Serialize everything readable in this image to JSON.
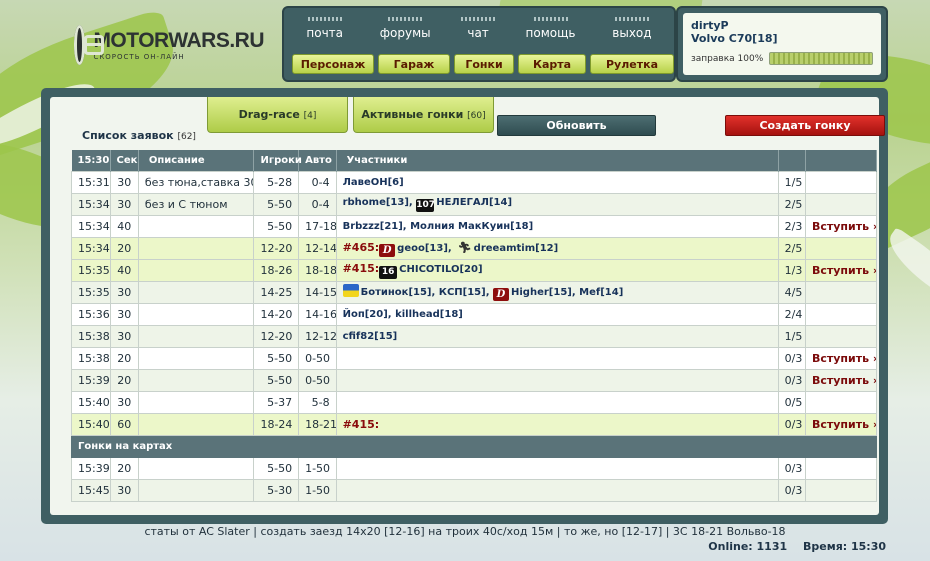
{
  "logo": {
    "title": "MOTORWARS.RU",
    "subtitle": "скорость он-лайн"
  },
  "nav": {
    "top": [
      "почта",
      "форумы",
      "чат",
      "помощь",
      "выход"
    ],
    "bottom": [
      "Персонаж",
      "Гараж",
      "Гонки",
      "Карта",
      "Рулетка"
    ]
  },
  "user": {
    "name": "dirtyP",
    "car": "Volvo C70[18]",
    "fuel_label": "заправка 100%",
    "fuel_level": 1.0
  },
  "panel": {
    "title": "Список заявок",
    "title_count": "[62]",
    "tab1_label": "Drag-race",
    "tab1_count": "[4]",
    "tab2_label": "Активные гонки",
    "tab2_count": "[60]",
    "refresh": "Обновить",
    "create": "Создать гонку"
  },
  "table": {
    "headers": [
      "15:30",
      "Сек",
      "Описание",
      "Игроки",
      "Авто",
      "Участники"
    ],
    "join_label": "Вступить »",
    "rows": [
      {
        "time": "15:31",
        "sec": "30",
        "desc": "без тюна,ставка 300",
        "players": "5-28",
        "auto": "0-4",
        "ppl": "ЛавеОН[6]",
        "count": "1/5",
        "join": false
      },
      {
        "time": "15:34",
        "sec": "30",
        "desc": "без и С тюном",
        "players": "5-50",
        "auto": "0-4",
        "ppl_a": "rbhome[13],",
        "ppl_b": "НЕЛЕГАЛ[14]",
        "clan_b": "107",
        "count": "2/5",
        "join": false
      },
      {
        "time": "15:34",
        "sec": "40",
        "desc": "",
        "players": "5-50",
        "auto": "17-18",
        "ppl": "Brbzzz[21], Молния МакКуин[18]",
        "count": "2/3",
        "join": true
      },
      {
        "time": "15:34",
        "sec": "20",
        "desc": "",
        "players": "12-20",
        "auto": "12-14",
        "num": "#465:",
        "ppl_a": "geoo[13],",
        "ppl_b": "dreeamtim[12]",
        "clan_a": "D",
        "count": "2/5",
        "join": false
      },
      {
        "time": "15:35",
        "sec": "40",
        "desc": "",
        "players": "18-26",
        "auto": "18-18",
        "num": "#415:",
        "ppl": "CHICOTILO[20]",
        "clan_a": "16",
        "count": "1/3",
        "join": true
      },
      {
        "time": "15:35",
        "sec": "30",
        "desc": "",
        "players": "14-25",
        "auto": "14-15",
        "ppl_a": "Ботинок[15], КСП[15],",
        "ppl_b": "Higher[15], Mef[14]",
        "clan_b": "D",
        "count": "4/5",
        "join": false
      },
      {
        "time": "15:36",
        "sec": "30",
        "desc": "",
        "players": "14-20",
        "auto": "14-16",
        "ppl": "Йоп[20], killhead[18]",
        "count": "2/4",
        "join": false
      },
      {
        "time": "15:38",
        "sec": "30",
        "desc": "",
        "players": "12-20",
        "auto": "12-12",
        "ppl": "cfif82[15]",
        "count": "1/5",
        "join": false
      },
      {
        "time": "15:38",
        "sec": "20",
        "desc": "",
        "players": "5-50",
        "auto": "0-50",
        "ppl": "",
        "count": "0/3",
        "join": true
      },
      {
        "time": "15:39",
        "sec": "20",
        "desc": "",
        "players": "5-50",
        "auto": "0-50",
        "ppl": "",
        "count": "0/3",
        "join": true
      },
      {
        "time": "15:40",
        "sec": "30",
        "desc": "",
        "players": "5-37",
        "auto": "5-8",
        "ppl": "",
        "count": "0/5",
        "join": false
      },
      {
        "time": "15:40",
        "sec": "60",
        "desc": "",
        "players": "18-24",
        "auto": "18-21",
        "num": "#415:",
        "ppl": "",
        "count": "0/3",
        "join": true
      }
    ],
    "section_title": "Гонки на картах",
    "map_rows": [
      {
        "time": "15:39",
        "sec": "20",
        "desc": "",
        "players": "5-50",
        "auto": "1-50",
        "count": "0/3"
      },
      {
        "time": "15:45",
        "sec": "30",
        "desc": "",
        "players": "5-30",
        "auto": "1-50",
        "count": "0/3"
      }
    ]
  },
  "footer": {
    "text": "статы от AC Slater | создать заезд 14х20 [12-16] на троих 40с/ход 15м | то же, но [12-17] | 3С 18-21 Вольво-18",
    "online": "Online: 1131",
    "time": "Время: 15:30"
  }
}
